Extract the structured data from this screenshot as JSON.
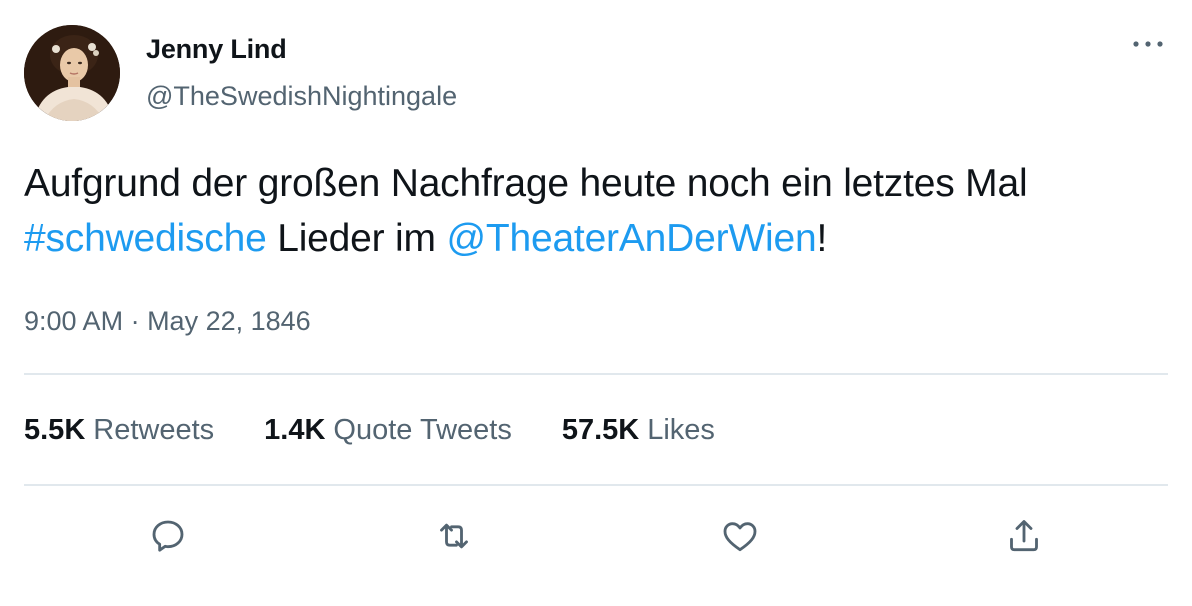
{
  "author": {
    "display_name": "Jenny Lind",
    "handle": "@TheSwedishNightingale",
    "avatar_alt": "Jenny Lind portrait"
  },
  "tweet": {
    "text_part1": "Aufgrund der großen Nachfrage heute noch ein letztes Mal ",
    "hashtag": "#schwedische",
    "text_part2": " Lieder im ",
    "mention": "@TheaterAnDerWien",
    "text_part3": "!",
    "time": "9:00 AM",
    "separator": " · ",
    "date": "May 22, 1846"
  },
  "stats": {
    "retweets": {
      "count": "5.5K",
      "label": "Retweets"
    },
    "quote_tweets": {
      "count": "1.4K",
      "label": "Quote Tweets"
    },
    "likes": {
      "count": "57.5K",
      "label": "Likes"
    }
  },
  "actions": {
    "reply_icon": "reply-icon",
    "retweet_icon": "retweet-icon",
    "like_icon": "heart-icon",
    "share_icon": "share-icon"
  },
  "colors": {
    "link": "#1d9bf0",
    "secondary_text": "#536471",
    "primary_text": "#0f1419",
    "divider": "#e1e8ed"
  }
}
